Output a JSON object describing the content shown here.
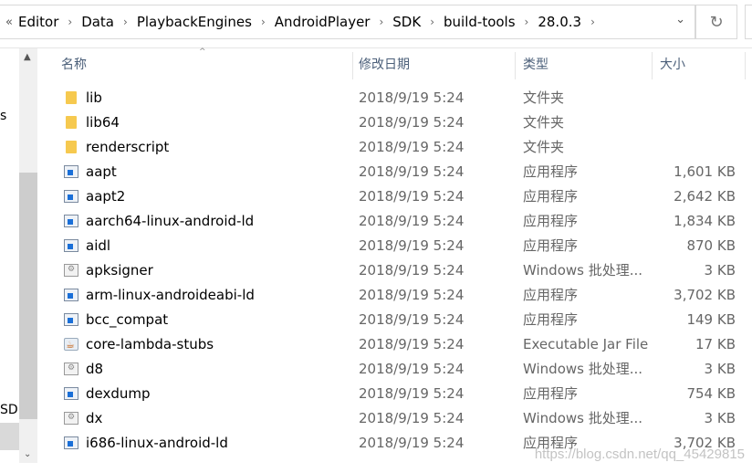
{
  "address_bar": {
    "overflow": "«",
    "crumbs": [
      "Editor",
      "Data",
      "PlaybackEngines",
      "AndroidPlayer",
      "SDK",
      "build-tools",
      "28.0.3"
    ]
  },
  "left_pane": {
    "partial_text_1": "s",
    "partial_text_2": "SD ("
  },
  "columns": {
    "name": "名称",
    "date": "修改日期",
    "type": "类型",
    "size": "大小"
  },
  "files": [
    {
      "name": "lib",
      "date": "2018/9/19 5:24",
      "type": "文件夹",
      "size": "",
      "icon": "folder"
    },
    {
      "name": "lib64",
      "date": "2018/9/19 5:24",
      "type": "文件夹",
      "size": "",
      "icon": "folder"
    },
    {
      "name": "renderscript",
      "date": "2018/9/19 5:24",
      "type": "文件夹",
      "size": "",
      "icon": "folder"
    },
    {
      "name": "aapt",
      "date": "2018/9/19 5:24",
      "type": "应用程序",
      "size": "1,601 KB",
      "icon": "app"
    },
    {
      "name": "aapt2",
      "date": "2018/9/19 5:24",
      "type": "应用程序",
      "size": "2,642 KB",
      "icon": "app"
    },
    {
      "name": "aarch64-linux-android-ld",
      "date": "2018/9/19 5:24",
      "type": "应用程序",
      "size": "1,834 KB",
      "icon": "app"
    },
    {
      "name": "aidl",
      "date": "2018/9/19 5:24",
      "type": "应用程序",
      "size": "870 KB",
      "icon": "app"
    },
    {
      "name": "apksigner",
      "date": "2018/9/19 5:24",
      "type": "Windows 批处理...",
      "size": "3 KB",
      "icon": "bat"
    },
    {
      "name": "arm-linux-androideabi-ld",
      "date": "2018/9/19 5:24",
      "type": "应用程序",
      "size": "3,702 KB",
      "icon": "app"
    },
    {
      "name": "bcc_compat",
      "date": "2018/9/19 5:24",
      "type": "应用程序",
      "size": "149 KB",
      "icon": "app"
    },
    {
      "name": "core-lambda-stubs",
      "date": "2018/9/19 5:24",
      "type": "Executable Jar File",
      "size": "17 KB",
      "icon": "jar"
    },
    {
      "name": "d8",
      "date": "2018/9/19 5:24",
      "type": "Windows 批处理...",
      "size": "3 KB",
      "icon": "bat"
    },
    {
      "name": "dexdump",
      "date": "2018/9/19 5:24",
      "type": "应用程序",
      "size": "754 KB",
      "icon": "app"
    },
    {
      "name": "dx",
      "date": "2018/9/19 5:24",
      "type": "Windows 批处理...",
      "size": "3 KB",
      "icon": "bat"
    },
    {
      "name": "i686-linux-android-ld",
      "date": "2018/9/19 5:24",
      "type": "应用程序",
      "size": "3,702 KB",
      "icon": "app"
    }
  ],
  "watermark": "https://blog.csdn.net/qq_45429815"
}
